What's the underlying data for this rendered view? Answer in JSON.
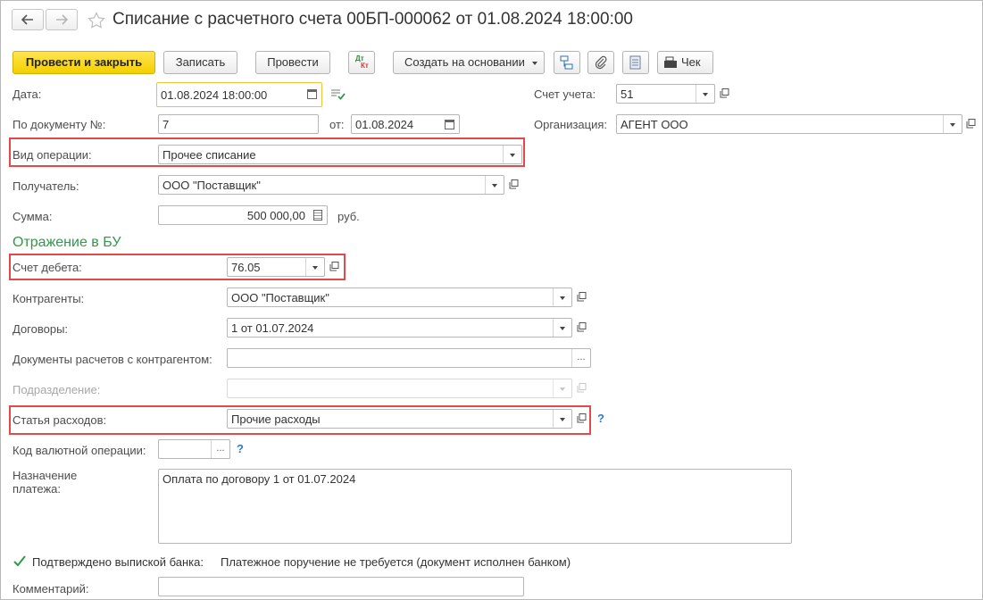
{
  "window": {
    "title": "Списание с расчетного счета 00БП-000062 от 01.08.2024 18:00:00"
  },
  "nav": {
    "back_icon": "arrow-left-icon",
    "forward_icon": "arrow-right-icon",
    "favorite_icon": "star-icon"
  },
  "toolbar": {
    "post_close": "Провести и закрыть",
    "save": "Записать",
    "post": "Провести",
    "dtkt_top": "Дт",
    "dtkt_bottom": "Кт",
    "create_based": "Создать на основании",
    "check": "Чек"
  },
  "form": {
    "date_label": "Дата:",
    "date_value": "01.08.2024 18:00:00",
    "doc_no_label": "По документу №:",
    "doc_no_value": "7",
    "from_label": "от:",
    "from_value": "01.08.2024",
    "op_type_label": "Вид операции:",
    "op_type_value": "Прочее списание",
    "recipient_label": "Получатель:",
    "recipient_value": "ООО \"Поставщик\"",
    "sum_label": "Сумма:",
    "sum_value": "500 000,00",
    "currency": "руб.",
    "account_label": "Счет учета:",
    "account_value": "51",
    "org_label": "Организация:",
    "org_value": "АГЕНТ ООО"
  },
  "bu": {
    "section_title": "Отражение в БУ",
    "debit_label": "Счет дебета:",
    "debit_value": "76.05",
    "counterparties_label": "Контрагенты:",
    "counterparties_value": "ООО \"Поставщик\"",
    "contracts_label": "Договоры:",
    "contracts_value": "1 от 01.07.2024",
    "settlement_docs_label": "Документы расчетов с контрагентом:",
    "settlement_docs_value": "",
    "division_label": "Подразделение:",
    "division_value": "",
    "expense_label": "Статья расходов:",
    "expense_value": "Прочие расходы"
  },
  "bottom": {
    "currency_op_label": "Код валютной операции:",
    "currency_op_value": "",
    "purpose_label_1": "Назначение",
    "purpose_label_2": "платежа:",
    "purpose_value": "Оплата по договору 1 от 01.07.2024",
    "confirmed_label": "Подтверждено выпиской банка:",
    "confirmed_checked": true,
    "payment_order_note": "Платежное поручение не требуется (документ исполнен банком)",
    "comment_label": "Комментарий:",
    "comment_value": ""
  },
  "misc": {
    "ellipsis": "...",
    "help": "?"
  },
  "colors": {
    "highlight": "#e04a4a",
    "primary_button": "#f4cf00",
    "section_title": "#2f9a48",
    "active_field_border": "#f0c23b"
  }
}
